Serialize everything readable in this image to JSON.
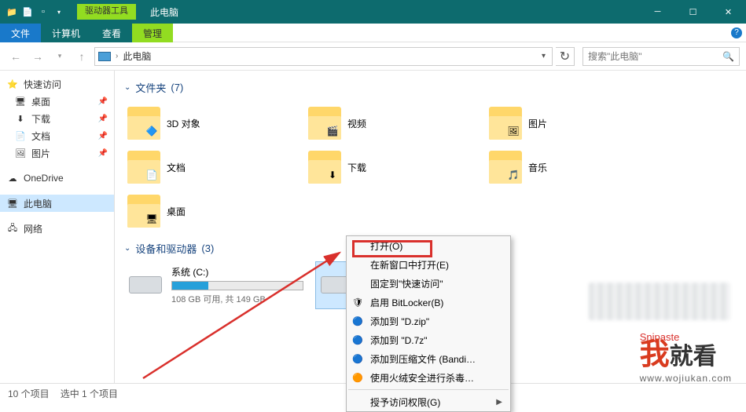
{
  "titlebar": {
    "contextual_tab": "驱动器工具",
    "title": "此电脑"
  },
  "menubar": {
    "file": "文件",
    "tabs": [
      "计算机",
      "查看"
    ],
    "manage": "管理"
  },
  "address": {
    "location": "此电脑",
    "search_placeholder": "搜索\"此电脑\""
  },
  "sidebar": {
    "quick": {
      "label": "快速访问",
      "items": [
        {
          "label": "桌面",
          "pin": true,
          "icon": "desktop"
        },
        {
          "label": "下载",
          "pin": true,
          "icon": "download"
        },
        {
          "label": "文档",
          "pin": true,
          "icon": "document"
        },
        {
          "label": "图片",
          "pin": true,
          "icon": "picture"
        }
      ]
    },
    "onedrive": "OneDrive",
    "thispc": "此电脑",
    "network": "网络"
  },
  "groups": {
    "folders": {
      "label": "文件夹",
      "count": "(7)",
      "items": [
        {
          "label": "3D 对象",
          "overlay": "🔷"
        },
        {
          "label": "视频",
          "overlay": "🎬"
        },
        {
          "label": "图片",
          "overlay": "🖼"
        },
        {
          "label": "文档",
          "overlay": "📄"
        },
        {
          "label": "下载",
          "overlay": "⬇"
        },
        {
          "label": "音乐",
          "overlay": "🎵"
        },
        {
          "label": "桌面",
          "overlay": "🖥"
        }
      ]
    },
    "drives": {
      "label": "设备和驱动器",
      "count": "(3)",
      "items": [
        {
          "title": "系统 (C:)",
          "sub": "108 GB 可用, 共 149 GB",
          "fill": 28
        }
      ]
    }
  },
  "snipaste": "Snipaste",
  "context_menu": [
    {
      "label": "打开(O)",
      "highlighted": true
    },
    {
      "label": "在新窗口中打开(E)"
    },
    {
      "label": "固定到\"快速访问\""
    },
    {
      "label": "启用 BitLocker(B)",
      "icon": "🛡"
    },
    {
      "label": "添加到 \"D.zip\"",
      "icon": "🔵"
    },
    {
      "label": "添加到 \"D.7z\"",
      "icon": "🔵"
    },
    {
      "label": "添加到压缩文件 (Bandizip)",
      "icon": "🔵",
      "truncated": true
    },
    {
      "label": "使用火绒安全进行杀毒",
      "icon": "🟠",
      "truncated": true
    },
    {
      "sep": true
    },
    {
      "label": "授予访问权限(G)",
      "submenu": true
    }
  ],
  "statusbar": {
    "count": "10 个项目",
    "selection": "选中 1 个项目"
  },
  "watermark": {
    "text_w": "我",
    "text_rest": "就看",
    "url": "www.wojiukan.com"
  }
}
